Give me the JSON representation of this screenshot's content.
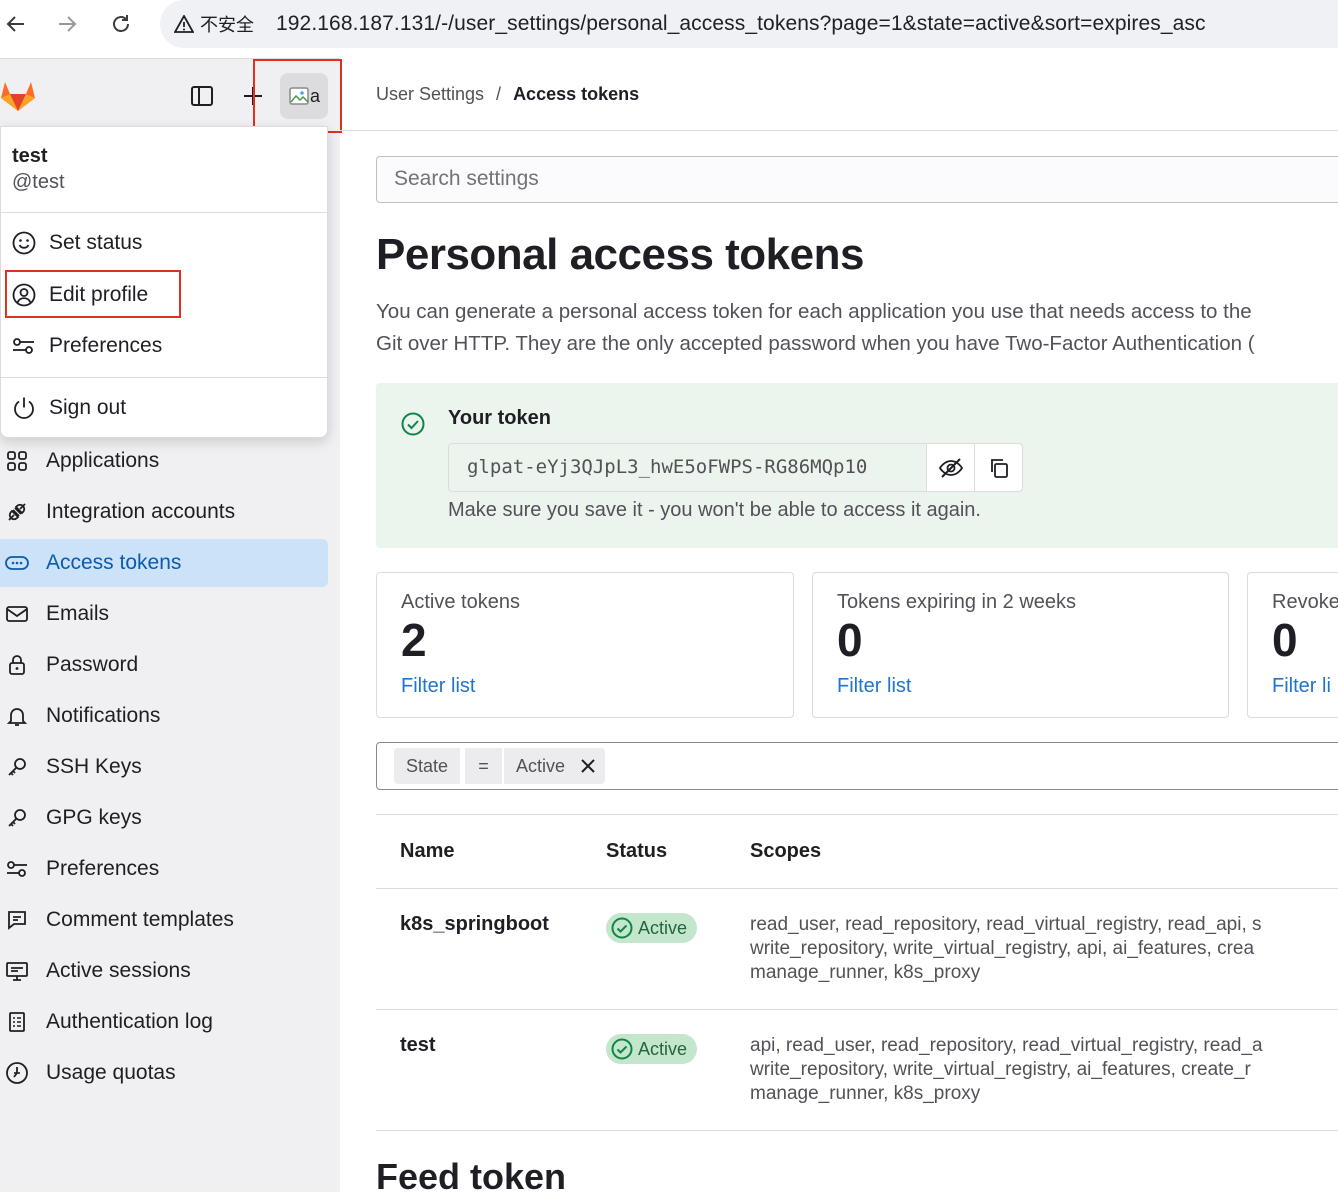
{
  "browser": {
    "insecure_label": "不安全",
    "url": "192.168.187.131/-/user_settings/personal_access_tokens?page=1&state=active&sort=expires_asc"
  },
  "sidebar": {
    "avatar_alt": "a",
    "items": [
      {
        "label": "Applications",
        "icon": "applications-icon"
      },
      {
        "label": "Integration accounts",
        "icon": "plug-icon"
      },
      {
        "label": "Access tokens",
        "icon": "token-icon",
        "active": true
      },
      {
        "label": "Emails",
        "icon": "mail-icon"
      },
      {
        "label": "Password",
        "icon": "lock-icon"
      },
      {
        "label": "Notifications",
        "icon": "bell-icon"
      },
      {
        "label": "SSH Keys",
        "icon": "key-icon"
      },
      {
        "label": "GPG keys",
        "icon": "key-icon"
      },
      {
        "label": "Preferences",
        "icon": "preferences-icon"
      },
      {
        "label": "Comment templates",
        "icon": "comment-icon"
      },
      {
        "label": "Active sessions",
        "icon": "monitor-icon"
      },
      {
        "label": "Authentication log",
        "icon": "log-icon"
      },
      {
        "label": "Usage quotas",
        "icon": "quota-icon"
      }
    ]
  },
  "user_menu": {
    "name": "test",
    "handle": "@test",
    "set_status": "Set status",
    "edit_profile": "Edit profile",
    "preferences": "Preferences",
    "sign_out": "Sign out"
  },
  "breadcrumb": {
    "parent": "User Settings",
    "separator": "/",
    "current": "Access tokens"
  },
  "search": {
    "placeholder": "Search settings"
  },
  "page": {
    "title": "Personal access tokens",
    "description_line1": "You can generate a personal access token for each application you use that needs access to the",
    "description_line2": "Git over HTTP. They are the only accepted password when you have Two-Factor Authentication ("
  },
  "token": {
    "title": "Your token",
    "value": "glpat-eYj3QJpL3_hwE5oFWPS-RG86MQp10",
    "note": "Make sure you save it - you won't be able to access it again."
  },
  "stats": [
    {
      "label": "Active tokens",
      "value": "2",
      "link": "Filter list"
    },
    {
      "label": "Tokens expiring in 2 weeks",
      "value": "0",
      "link": "Filter list"
    },
    {
      "label": "Revoke",
      "value": "0",
      "link": "Filter li"
    }
  ],
  "filter": {
    "field": "State",
    "operator": "=",
    "value": "Active"
  },
  "table": {
    "headers": {
      "name": "Name",
      "status": "Status",
      "scopes": "Scopes"
    },
    "rows": [
      {
        "name": "k8s_springboot",
        "status": "Active",
        "scopes_line1": "read_user, read_repository, read_virtual_registry, read_api, s",
        "scopes_line2": "write_repository, write_virtual_registry, api, ai_features, crea",
        "scopes_line3": "manage_runner, k8s_proxy"
      },
      {
        "name": "test",
        "status": "Active",
        "scopes_line1": "api, read_user, read_repository, read_virtual_registry, read_a",
        "scopes_line2": "write_repository, write_virtual_registry, ai_features, create_r",
        "scopes_line3": "manage_runner, k8s_proxy"
      }
    ]
  },
  "feed": {
    "title": "Feed token"
  },
  "colors": {
    "accent": "#1f75cb",
    "active_nav_bg": "#cbe2f9",
    "success": "#108548",
    "highlight_box": "#e0301e"
  }
}
